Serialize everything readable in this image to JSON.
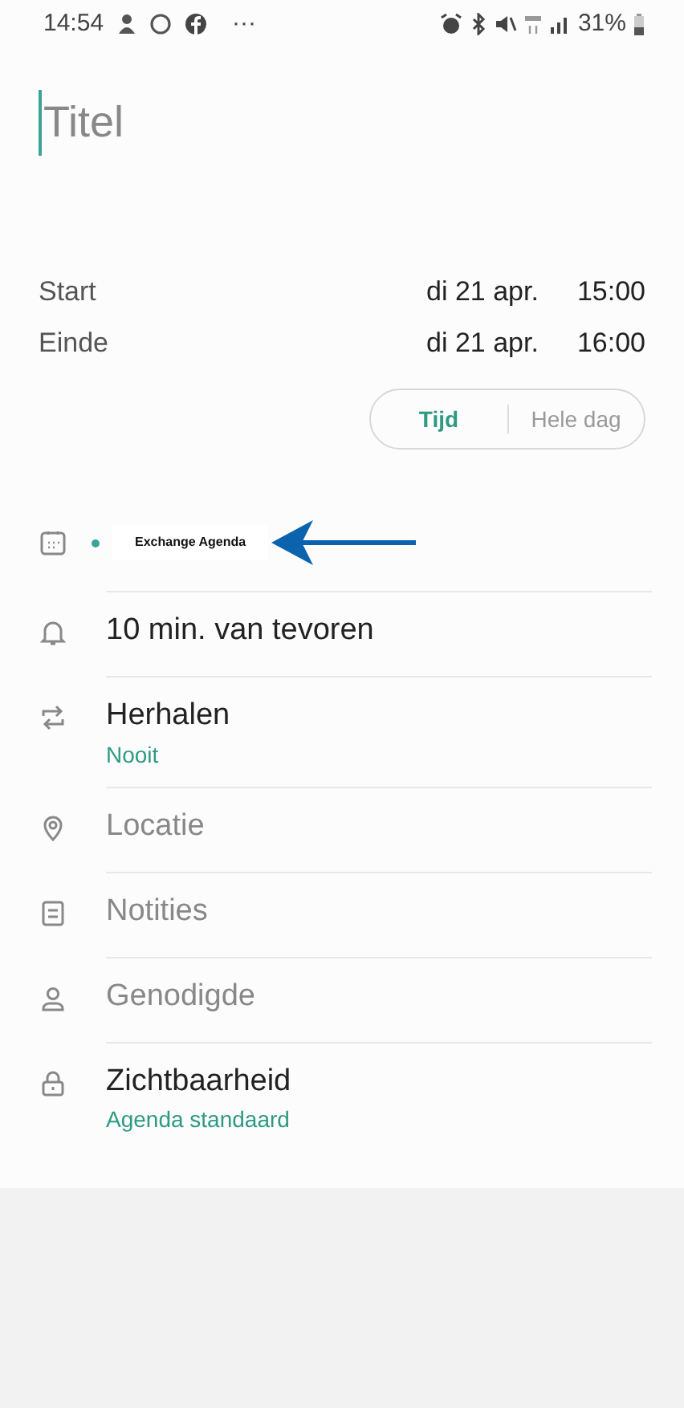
{
  "status_bar": {
    "time": "14:54",
    "more": "···",
    "battery": "31%"
  },
  "title": {
    "placeholder": "Titel"
  },
  "times": [
    {
      "label": "Start",
      "date": "di 21 apr.",
      "time": "15:00"
    },
    {
      "label": "Einde",
      "date": "di 21 apr.",
      "time": "16:00"
    }
  ],
  "mode_toggle": [
    {
      "label": "Tijd",
      "selected": true
    },
    {
      "label": "Hele dag",
      "selected": false
    }
  ],
  "calendar": {
    "name": "Exchange Agenda",
    "color": "#3aa596"
  },
  "rows": [
    {
      "kind": "value",
      "text": "10 min. van tevoren"
    },
    {
      "kind": "value",
      "text": "Herhalen",
      "sub": "Nooit"
    },
    {
      "kind": "placeholder",
      "text": "Locatie"
    },
    {
      "kind": "placeholder",
      "text": "Notities"
    },
    {
      "kind": "placeholder",
      "text": "Genodigde"
    },
    {
      "kind": "value",
      "text": "Zichtbaarheid",
      "sub": "Agenda standaard"
    }
  ]
}
